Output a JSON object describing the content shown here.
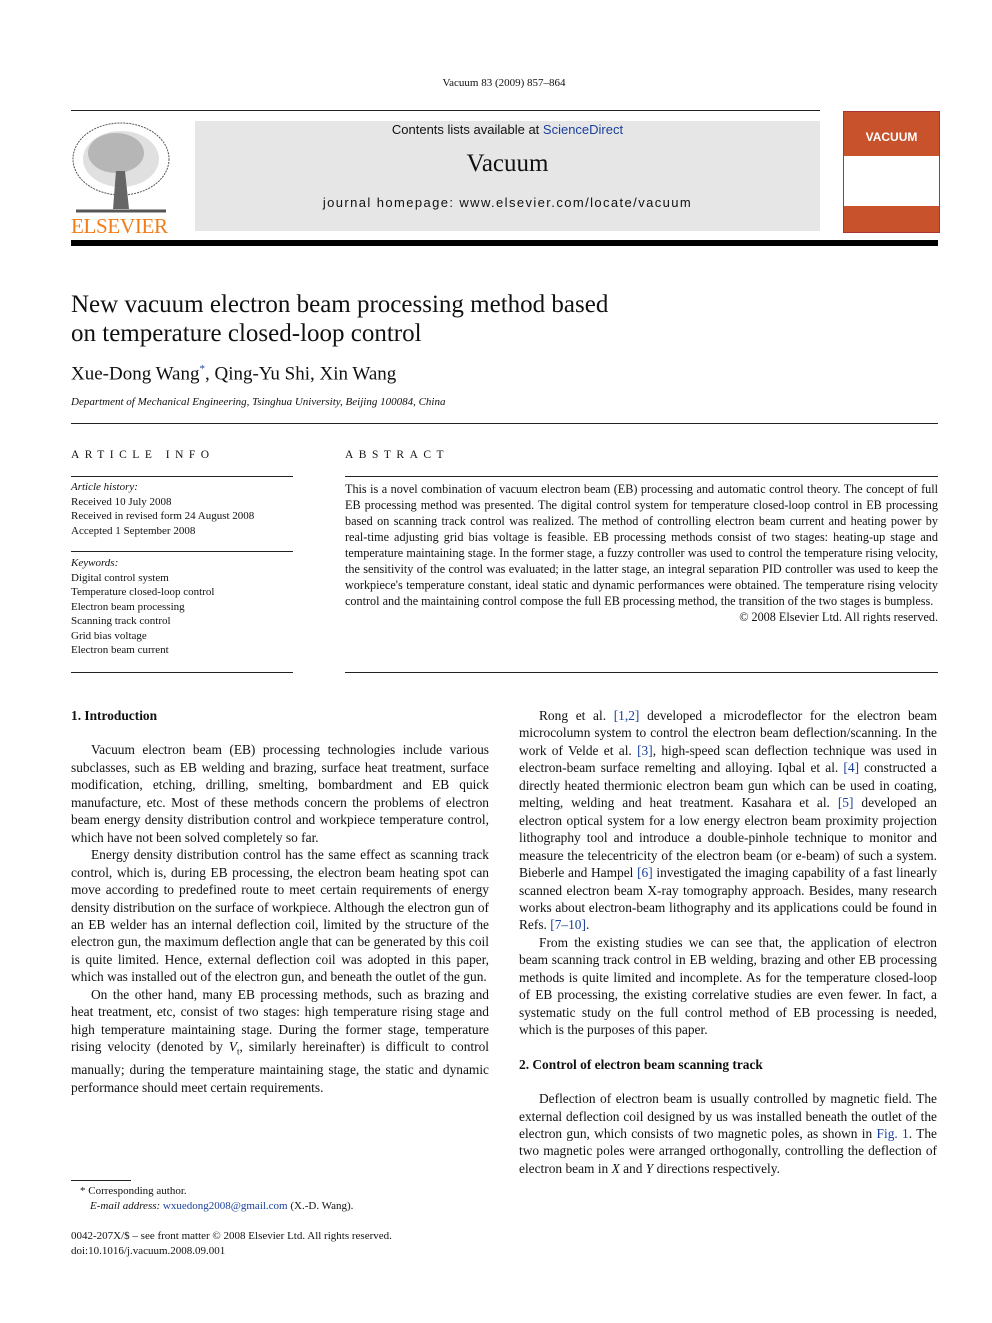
{
  "running_header": "Vacuum 83 (2009) 857–864",
  "banner": {
    "contents_prefix": "Contents lists available at ",
    "contents_link": "ScienceDirect",
    "journal": "Vacuum",
    "homepage": "journal homepage: www.elsevier.com/locate/vacuum"
  },
  "publisher_logo": "ELSEVIER",
  "cover": {
    "title": "VACUUM"
  },
  "title_lines": [
    "New vacuum electron beam processing method based",
    "on temperature closed-loop control"
  ],
  "authors": {
    "a1": "Xue-Dong Wang",
    "mark": "*",
    "rest": ", Qing-Yu Shi, Xin Wang"
  },
  "affiliation": "Department of Mechanical Engineering, Tsinghua University, Beijing 100084, China",
  "article_info": {
    "heading": "ARTICLE INFO",
    "history_label": "Article history:",
    "history": [
      "Received 10 July 2008",
      "Received in revised form 24 August 2008",
      "Accepted 1 September 2008"
    ],
    "keywords_label": "Keywords:",
    "keywords": [
      "Digital control system",
      "Temperature closed-loop control",
      "Electron beam processing",
      "Scanning track control",
      "Grid bias voltage",
      "Electron beam current"
    ]
  },
  "abstract": {
    "heading": "ABSTRACT",
    "text": "This is a novel combination of vacuum electron beam (EB) processing and automatic control theory. The concept of full EB processing method was presented. The digital control system for temperature closed-loop control in EB processing based on scanning track control was realized. The method of controlling electron beam current and heating power by real-time adjusting grid bias voltage is feasible. EB processing methods consist of two stages: heating-up stage and temperature maintaining stage. In the former stage, a fuzzy controller was used to control the temperature rising velocity, the sensitivity of the control was evaluated; in the latter stage, an integral separation PID controller was used to keep the workpiece's temperature constant, ideal static and dynamic performances were obtained. The temperature rising velocity control and the maintaining control compose the full EB processing method, the transition of the two stages is bumpless.",
    "copyright": "© 2008 Elsevier Ltd. All rights reserved."
  },
  "left_column": {
    "heading": "1.  Introduction",
    "paragraphs": [
      [
        {
          "t": "Vacuum electron beam (EB) processing technologies include various subclasses, such as EB welding and brazing, surface heat treatment, surface modification, etching, drilling, smelting, bombardment and EB quick manufacture, etc. Most of these methods concern the problems of electron beam energy density distribution control and workpiece temperature control, which have not been solved completely so far."
        }
      ],
      [
        {
          "t": "Energy density distribution control has the same effect as scanning track control, which is, during EB processing, the electron beam heating spot can move according to predefined route to meet certain requirements of energy density distribution on the surface of workpiece. Although the electron gun of an EB welder has an internal deflection coil, limited by the structure of the electron gun, the maximum deflection angle that can be generated by this coil is quite limited. Hence, external deflection coil was adopted in this paper, which was installed out of the electron gun, and beneath the outlet of the gun."
        }
      ],
      [
        {
          "t": "On the other hand, many EB processing methods, such as brazing and heat treatment, etc, consist of two stages: high temperature rising stage and high temperature maintaining stage. During the former stage, temperature rising velocity (denoted by "
        },
        {
          "t": "V",
          "i": true
        },
        {
          "t": "t",
          "sub": true
        },
        {
          "t": ", similarly hereinafter) is difficult to control manually; during the temperature maintaining stage, the static and dynamic performance should meet certain requirements."
        }
      ]
    ]
  },
  "right_column": {
    "paragraphs": [
      [
        {
          "t": "Rong et al. "
        },
        {
          "t": "[1,2]",
          "link": true
        },
        {
          "t": " developed a microdeflector for the electron beam microcolumn system to control the electron beam deflection/scanning. In the work of Velde et al. "
        },
        {
          "t": "[3]",
          "link": true
        },
        {
          "t": ", high-speed scan deflection technique was used in electron-beam surface remelting and alloying. Iqbal et al. "
        },
        {
          "t": "[4]",
          "link": true
        },
        {
          "t": " constructed a directly heated thermionic electron beam gun which can be used in coating, melting, welding and heat treatment. Kasahara et al. "
        },
        {
          "t": "[5]",
          "link": true
        },
        {
          "t": " developed an electron optical system for a low energy electron beam proximity projection lithography tool and introduce a double-pinhole technique to monitor and measure the telecentricity of the electron beam (or e-beam) of such a system. Bieberle and Hampel "
        },
        {
          "t": "[6]",
          "link": true
        },
        {
          "t": " investigated the imaging capability of a fast linearly scanned electron beam X-ray tomography approach. Besides, many research works about electron-beam lithography and its applications could be found in Refs. "
        },
        {
          "t": "[7–10]",
          "link": true
        },
        {
          "t": "."
        }
      ],
      [
        {
          "t": "From the existing studies we can see that, the application of electron beam scanning track control in EB welding, brazing and other EB processing methods is quite limited and incomplete. As for the temperature closed-loop of EB processing, the existing correlative studies are even fewer. In fact, a systematic study on the full control method of EB processing is needed, which is the purposes of this paper."
        }
      ]
    ],
    "heading": "2.  Control of electron beam scanning track",
    "paragraphs2": [
      [
        {
          "t": "Deflection of electron beam is usually controlled by magnetic field. The external deflection coil designed by us was installed beneath the outlet of the electron gun, which consists of two magnetic poles, as shown in "
        },
        {
          "t": "Fig. 1",
          "link": true
        },
        {
          "t": ". The two magnetic poles were arranged orthogonally, controlling the deflection of electron beam in "
        },
        {
          "t": "X",
          "i": true
        },
        {
          "t": " and "
        },
        {
          "t": "Y",
          "i": true
        },
        {
          "t": " directions respectively."
        }
      ]
    ]
  },
  "footnote": {
    "mark": "*",
    "text": "Corresponding author.",
    "email_label": "E-mail address: ",
    "email": "wxuedong2008@gmail.com",
    "email_suffix": " (X.-D. Wang)."
  },
  "front_matter": [
    "0042-207X/$ – see front matter © 2008 Elsevier Ltd. All rights reserved.",
    "doi:10.1016/j.vacuum.2008.09.001"
  ],
  "colors": {
    "link": "#1a3f9c",
    "elsevier_orange": "#f07d1a",
    "cover": "#c8522c",
    "banner_bg": "#e6e6e6"
  }
}
